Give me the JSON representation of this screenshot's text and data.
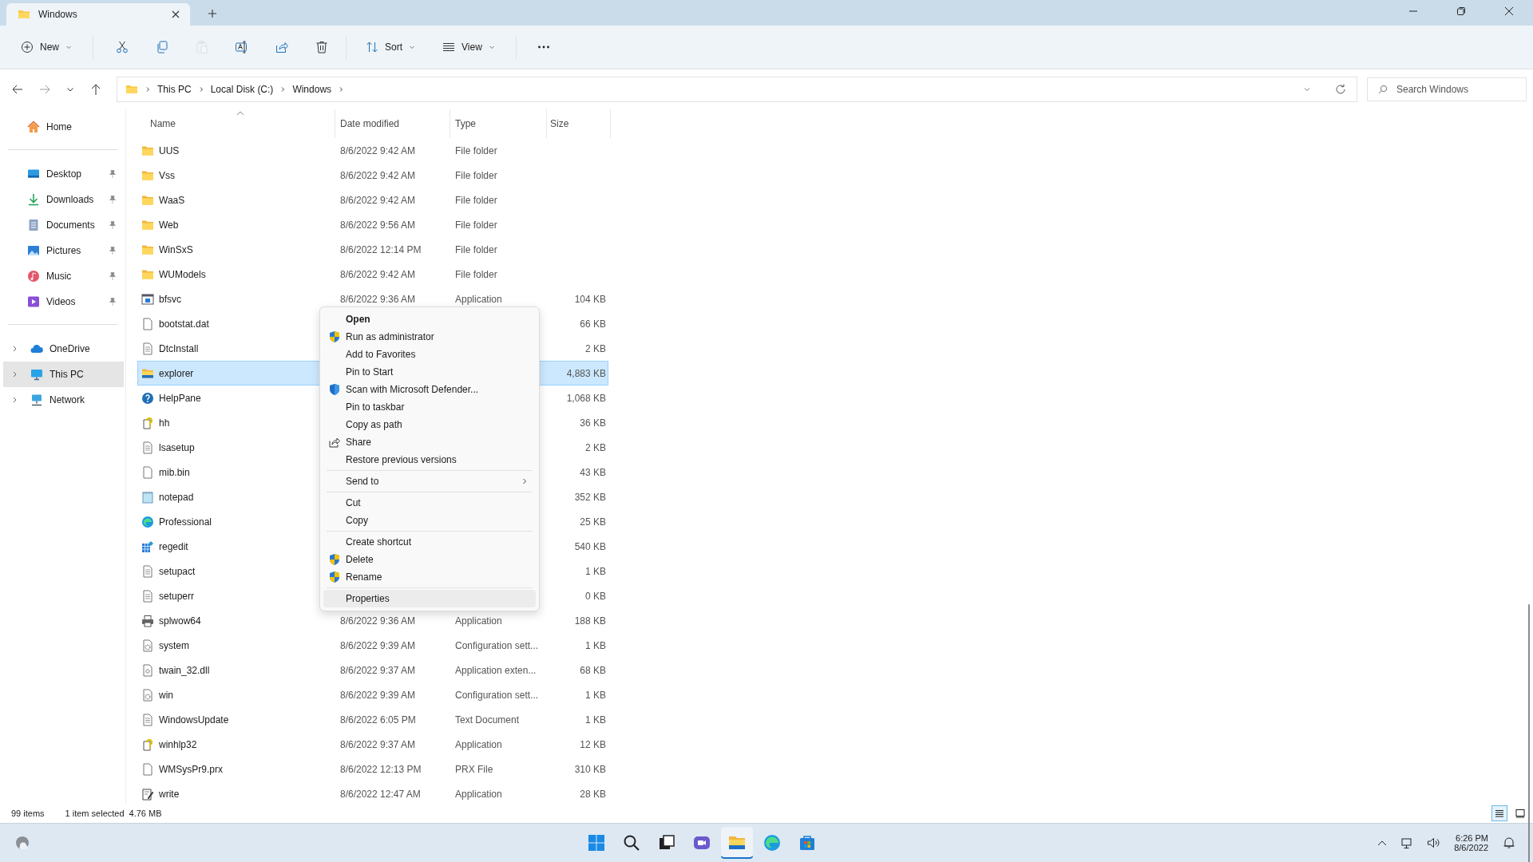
{
  "window": {
    "tab_title": "Windows"
  },
  "toolbar": {
    "new_label": "New",
    "sort_label": "Sort",
    "view_label": "View",
    "tools": [
      {
        "kind": "cut",
        "disabled": false
      },
      {
        "kind": "copy",
        "disabled": false
      },
      {
        "kind": "paste",
        "disabled": true
      },
      {
        "kind": "rename",
        "disabled": false
      },
      {
        "kind": "share",
        "disabled": false
      },
      {
        "kind": "delete",
        "disabled": false
      }
    ]
  },
  "address": {
    "breadcrumbs": [
      "This PC",
      "Local Disk (C:)",
      "Windows"
    ]
  },
  "search": {
    "placeholder": "Search Windows"
  },
  "sidebar": {
    "home": "Home",
    "pinned": [
      {
        "label": "Desktop",
        "kind": "desktop"
      },
      {
        "label": "Downloads",
        "kind": "downloads"
      },
      {
        "label": "Documents",
        "kind": "documents"
      },
      {
        "label": "Pictures",
        "kind": "pictures"
      },
      {
        "label": "Music",
        "kind": "music"
      },
      {
        "label": "Videos",
        "kind": "videos"
      }
    ],
    "locations": [
      {
        "label": "OneDrive",
        "kind": "cloud",
        "selected": false
      },
      {
        "label": "This PC",
        "kind": "pc",
        "selected": true
      },
      {
        "label": "Network",
        "kind": "network",
        "selected": false
      }
    ]
  },
  "table": {
    "columns": [
      {
        "label": "Name",
        "sorted": true
      },
      {
        "label": "Date modified",
        "sorted": false
      },
      {
        "label": "Type",
        "sorted": false
      },
      {
        "label": "Size",
        "sorted": false
      }
    ],
    "rows": [
      {
        "name": "UUS",
        "kind": "folder",
        "date": "8/6/2022 9:42 AM",
        "type": "File folder",
        "selected": false
      },
      {
        "name": "Vss",
        "kind": "folder",
        "date": "8/6/2022 9:42 AM",
        "type": "File folder",
        "selected": false
      },
      {
        "name": "WaaS",
        "kind": "folder",
        "date": "8/6/2022 9:42 AM",
        "type": "File folder",
        "selected": false
      },
      {
        "name": "Web",
        "kind": "folder",
        "date": "8/6/2022 9:56 AM",
        "type": "File folder",
        "selected": false
      },
      {
        "name": "WinSxS",
        "kind": "folder",
        "date": "8/6/2022 12:14 PM",
        "type": "File folder",
        "selected": false
      },
      {
        "name": "WUModels",
        "kind": "folder",
        "date": "8/6/2022 9:42 AM",
        "type": "File folder",
        "selected": false
      },
      {
        "name": "bfsvc",
        "kind": "app",
        "date": "8/6/2022 9:36 AM",
        "type": "Application",
        "size": "104 KB",
        "selected": false
      },
      {
        "name": "bootstat.dat",
        "kind": "file",
        "size": "66 KB",
        "selected": false
      },
      {
        "name": "DtcInstall",
        "kind": "text",
        "size": "2 KB",
        "selected": false
      },
      {
        "name": "explorer",
        "kind": "explorer",
        "size": "4,883 KB",
        "selected": true
      },
      {
        "name": "HelpPane",
        "kind": "help",
        "size": "1,068 KB",
        "selected": false
      },
      {
        "name": "hh",
        "kind": "hh",
        "size": "36 KB",
        "selected": false
      },
      {
        "name": "lsasetup",
        "kind": "text",
        "size": "2 KB",
        "selected": false
      },
      {
        "name": "mib.bin",
        "kind": "file",
        "size": "43 KB",
        "selected": false
      },
      {
        "name": "notepad",
        "kind": "notepad",
        "size": "352 KB",
        "selected": false
      },
      {
        "name": "Professional",
        "kind": "edge",
        "size": "25 KB",
        "selected": false
      },
      {
        "name": "regedit",
        "kind": "regedit",
        "size": "540 KB",
        "selected": false
      },
      {
        "name": "setupact",
        "kind": "text",
        "size": "1 KB",
        "selected": false
      },
      {
        "name": "setuperr",
        "kind": "text",
        "size": "0 KB",
        "selected": false
      },
      {
        "name": "splwow64",
        "kind": "printer",
        "date": "8/6/2022 9:36 AM",
        "type": "Application",
        "size": "188 KB",
        "selected": false
      },
      {
        "name": "system",
        "kind": "config",
        "date": "8/6/2022 9:39 AM",
        "type": "Configuration sett...",
        "size": "1 KB",
        "selected": false
      },
      {
        "name": "twain_32.dll",
        "kind": "dll",
        "date": "8/6/2022 9:37 AM",
        "type": "Application exten...",
        "size": "68 KB",
        "selected": false
      },
      {
        "name": "win",
        "kind": "config",
        "date": "8/6/2022 9:39 AM",
        "type": "Configuration sett...",
        "size": "1 KB",
        "selected": false
      },
      {
        "name": "WindowsUpdate",
        "kind": "text",
        "date": "8/6/2022 6:05 PM",
        "type": "Text Document",
        "size": "1 KB",
        "selected": false
      },
      {
        "name": "winhlp32",
        "kind": "hh",
        "date": "8/6/2022 9:37 AM",
        "type": "Application",
        "size": "12 KB",
        "selected": false
      },
      {
        "name": "WMSysPr9.prx",
        "kind": "file",
        "date": "8/6/2022 12:13 PM",
        "type": "PRX File",
        "size": "310 KB",
        "selected": false
      },
      {
        "name": "write",
        "kind": "write",
        "date": "8/6/2022 12:47 AM",
        "type": "Application",
        "size": "28 KB",
        "selected": false
      }
    ]
  },
  "context_menu": [
    {
      "kind": "item",
      "label": "Open",
      "default": true,
      "highlighted": false
    },
    {
      "kind": "shield-item",
      "label": "Run as administrator",
      "default": false,
      "highlighted": false
    },
    {
      "kind": "item",
      "label": "Add to Favorites",
      "default": false,
      "highlighted": false
    },
    {
      "kind": "item",
      "label": "Pin to Start",
      "default": false,
      "highlighted": false
    },
    {
      "kind": "defender-item",
      "label": "Scan with Microsoft Defender...",
      "default": false,
      "highlighted": false
    },
    {
      "kind": "item",
      "label": "Pin to taskbar",
      "default": false,
      "highlighted": false
    },
    {
      "kind": "item",
      "label": "Copy as path",
      "default": false,
      "highlighted": false
    },
    {
      "kind": "share-item",
      "label": "Share",
      "default": false,
      "highlighted": false
    },
    {
      "kind": "item",
      "label": "Restore previous versions",
      "default": false,
      "highlighted": false
    },
    {
      "kind": "separator"
    },
    {
      "kind": "item",
      "label": "Send to",
      "submenu": true,
      "default": false,
      "highlighted": false
    },
    {
      "kind": "separator"
    },
    {
      "kind": "item",
      "label": "Cut",
      "default": false,
      "highlighted": false
    },
    {
      "kind": "item",
      "label": "Copy",
      "default": false,
      "highlighted": false
    },
    {
      "kind": "separator"
    },
    {
      "kind": "item",
      "label": "Create shortcut",
      "default": false,
      "highlighted": false
    },
    {
      "kind": "shield-item",
      "label": "Delete",
      "default": false,
      "highlighted": false
    },
    {
      "kind": "shield-item",
      "label": "Rename",
      "default": false,
      "highlighted": false
    },
    {
      "kind": "separator"
    },
    {
      "kind": "item",
      "label": "Properties",
      "default": false,
      "highlighted": true
    }
  ],
  "status_bar": {
    "count": "99 items",
    "selection": "1 item selected",
    "size": "4.76 MB"
  },
  "view_buttons": [
    {
      "kind": "details",
      "selected": true
    },
    {
      "kind": "tiles",
      "selected": false
    }
  ],
  "taskbar": {
    "apps": [
      {
        "kind": "start",
        "active": false
      },
      {
        "kind": "search",
        "active": false
      },
      {
        "kind": "taskview",
        "active": false
      },
      {
        "kind": "chat",
        "active": false
      },
      {
        "kind": "explorer",
        "active": true
      },
      {
        "kind": "edge",
        "active": false
      },
      {
        "kind": "store",
        "active": false
      }
    ],
    "time": "6:26 PM",
    "date": "8/6/2022"
  }
}
